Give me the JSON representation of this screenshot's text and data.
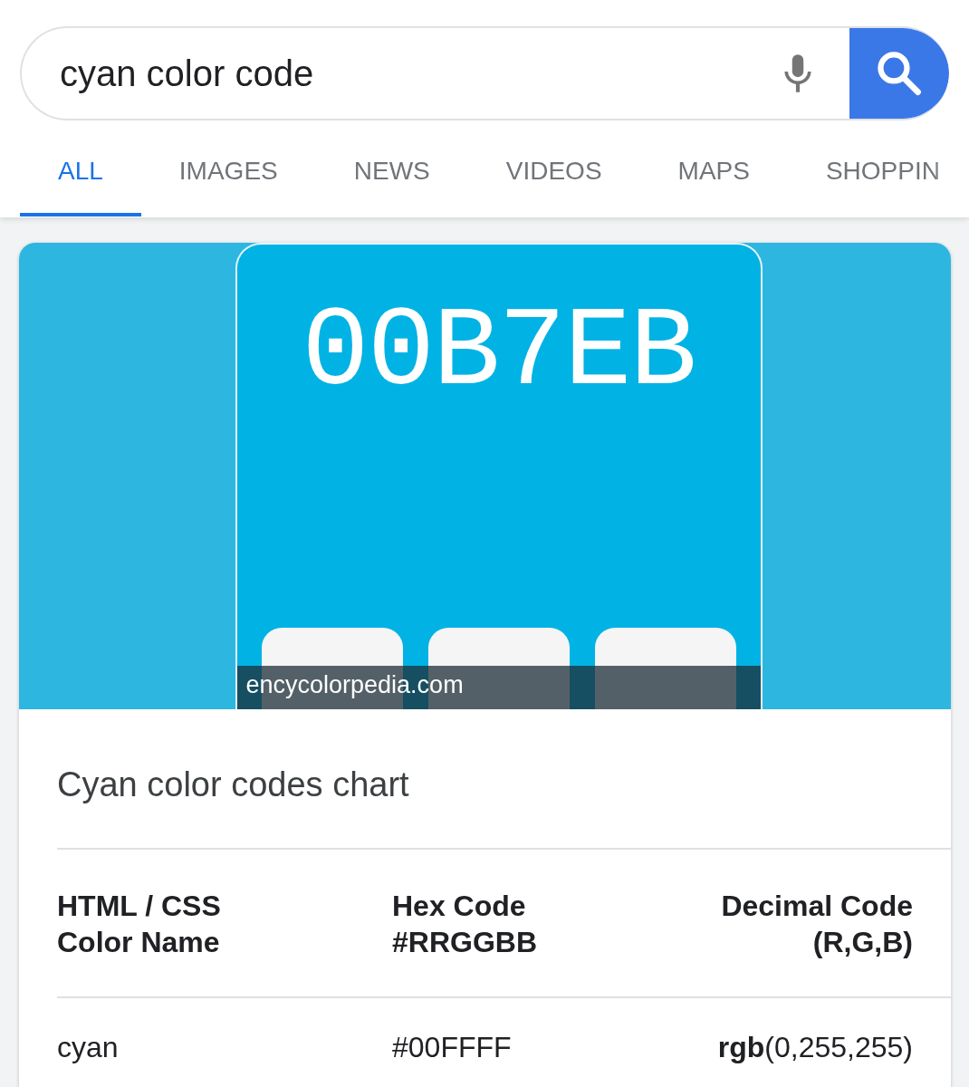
{
  "search": {
    "value": "cyan color code"
  },
  "tabs": [
    {
      "label": "ALL",
      "selected": true
    },
    {
      "label": "IMAGES",
      "selected": false
    },
    {
      "label": "NEWS",
      "selected": false
    },
    {
      "label": "VIDEOS",
      "selected": false
    },
    {
      "label": "MAPS",
      "selected": false
    },
    {
      "label": "SHOPPIN",
      "selected": false
    }
  ],
  "image": {
    "hex": "00B7EB",
    "source": "encycolorpedia.com"
  },
  "card": {
    "title": "Cyan color codes chart",
    "table": {
      "columns": [
        "HTML / CSS Color Name",
        "Hex Code #RRGGBB",
        "Decimal Code (R,G,B)"
      ],
      "rows": [
        [
          "cyan",
          "#00FFFF",
          "**rgb**(0,255,255)"
        ]
      ]
    }
  }
}
